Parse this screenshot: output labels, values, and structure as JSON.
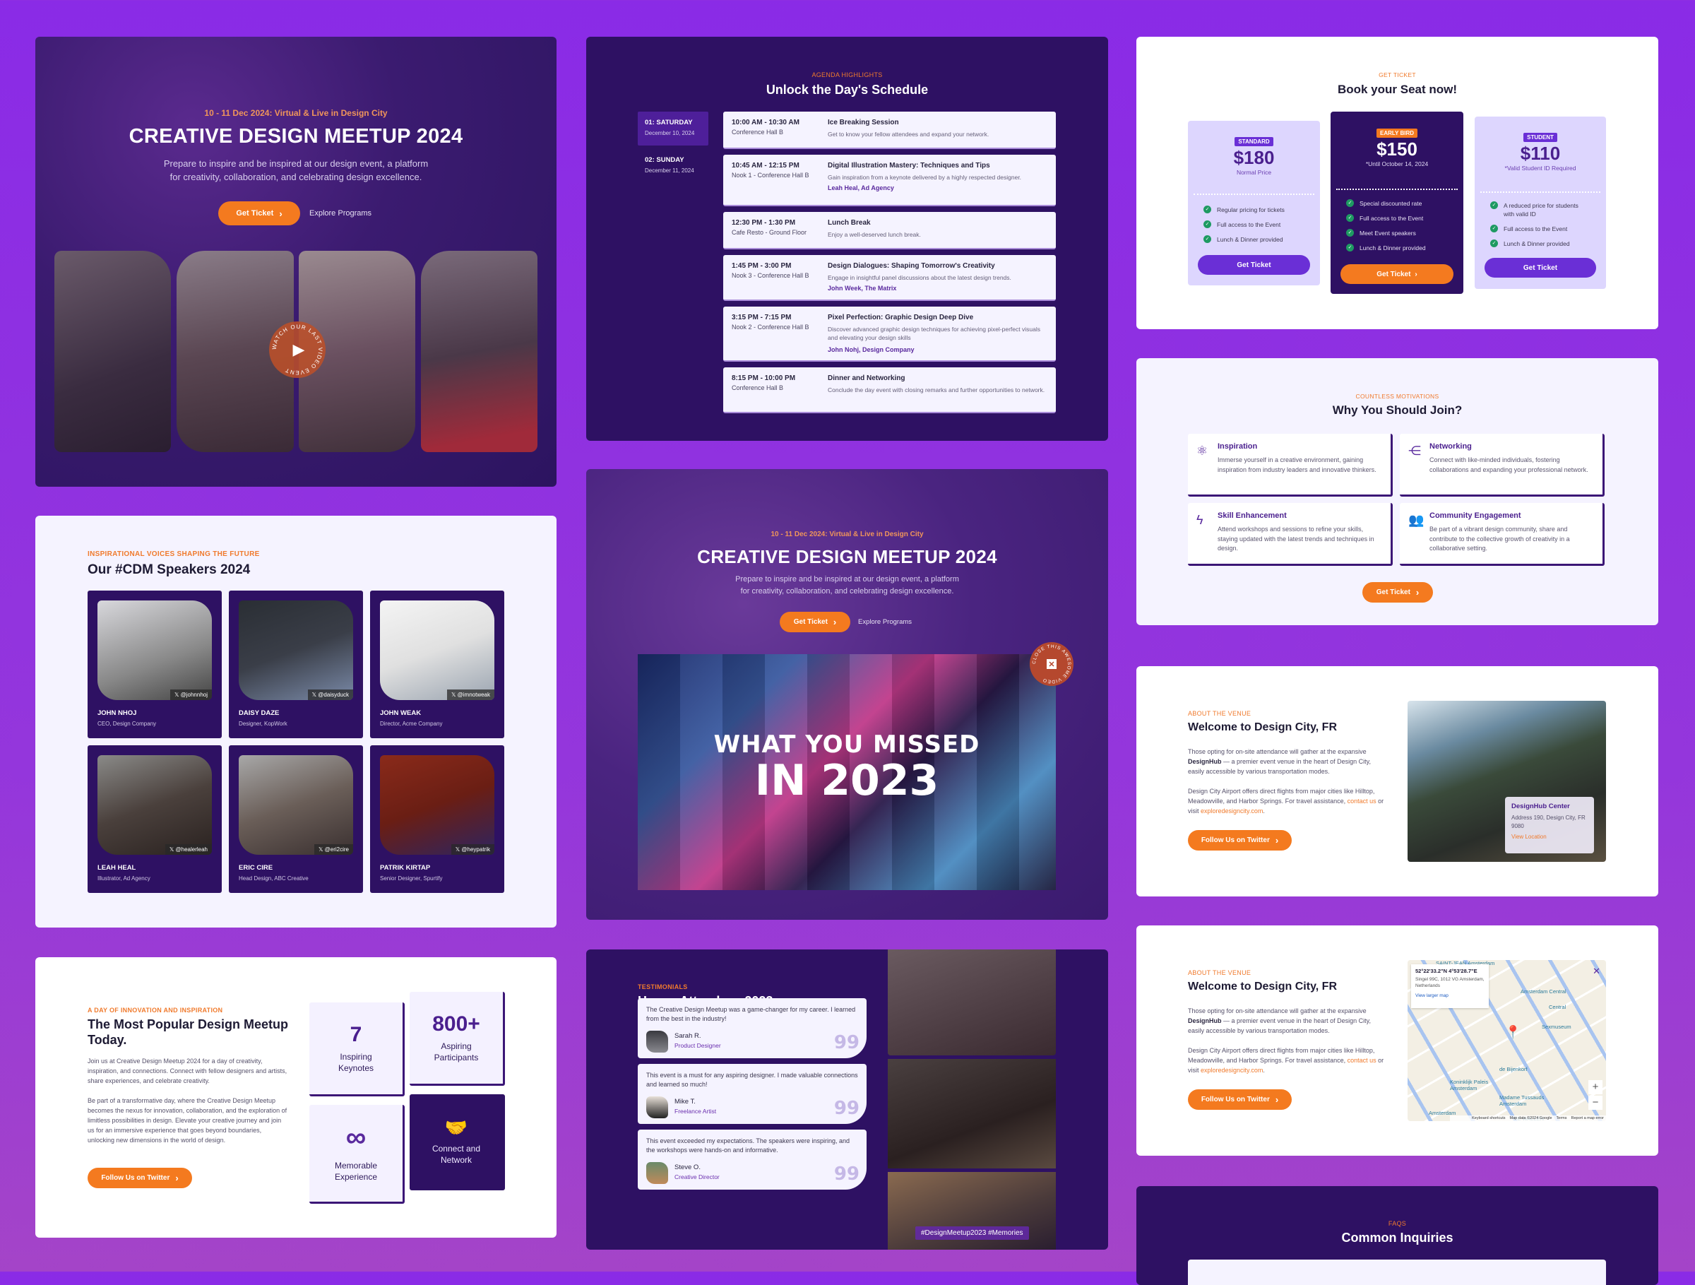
{
  "hero": {
    "date_line": "10 - 11 Dec 2024: Virtual & Live in Design City",
    "title": "CREATIVE DESIGN MEETUP 2024",
    "subtitle_1": "Prepare to inspire and be inspired at our design event, a platform",
    "subtitle_2": "for creativity, collaboration, and celebrating design excellence.",
    "get_ticket": "Get Ticket",
    "explore": "Explore Programs",
    "watch_badge": "WATCH OUR LAST VIDEO EVENT",
    "play_icon": "play-icon"
  },
  "hero_video": {
    "date_line": "10 - 11 Dec 2024: Virtual & Live in Design City",
    "title": "CREATIVE DESIGN MEETUP 2024",
    "subtitle_1": "Prepare to inspire and be inspired at our design event, a platform",
    "subtitle_2": "for creativity, collaboration, and celebrating design excellence.",
    "get_ticket": "Get Ticket",
    "explore": "Explore Programs",
    "video_line_1": "WHAT YOU MISSED",
    "video_line_2": "IN 2023",
    "close_badge": "CLOSE THIS AWESOME VIDEO"
  },
  "schedule": {
    "eyebrow": "AGENDA HIGHLIGHTS",
    "title": "Unlock the Day's Schedule",
    "days": [
      {
        "label": "01: SATURDAY",
        "date": "December 10, 2024",
        "active": true
      },
      {
        "label": "02: SUNDAY",
        "date": "December 11, 2024",
        "active": false
      }
    ],
    "sessions": [
      {
        "time": "10:00 AM - 10:30 AM",
        "location": "Conference Hall B",
        "title": "Ice Breaking Session",
        "desc": "Get to know your fellow attendees and expand your network.",
        "speaker": ""
      },
      {
        "time": "10:45 AM - 12:15 PM",
        "location": "Nook 1 - Conference Hall B",
        "title": "Digital Illustration Mastery: Techniques and Tips",
        "desc": "Gain inspiration from a keynote delivered by a highly respected designer.",
        "speaker": "Leah Heal, Ad Agency"
      },
      {
        "time": "12:30 PM - 1:30 PM",
        "location": "Cafe Resto - Ground Floor",
        "title": "Lunch Break",
        "desc": "Enjoy a well-deserved lunch break.",
        "speaker": ""
      },
      {
        "time": "1:45 PM - 3:00 PM",
        "location": "Nook 3 - Conference Hall B",
        "title": "Design Dialogues: Shaping Tomorrow's Creativity",
        "desc": "Engage in insightful panel discussions about the latest design trends.",
        "speaker": "John Week, The Matrix"
      },
      {
        "time": "3:15 PM - 7:15 PM",
        "location": "Nook 2 - Conference Hall B",
        "title": "Pixel Perfection: Graphic Design Deep Dive",
        "desc": "Discover advanced graphic design techniques for achieving pixel-perfect visuals and elevating your design skills",
        "speaker": "John Nohj, Design Company"
      },
      {
        "time": "8:15 PM - 10:00 PM",
        "location": "Conference Hall B",
        "title": "Dinner and Networking",
        "desc": "Conclude the day event with closing remarks and further opportunities to network.",
        "speaker": ""
      }
    ]
  },
  "pricing": {
    "eyebrow": "GET TICKET",
    "title": "Book your Seat now!",
    "plans": [
      {
        "badge": "STANDARD",
        "price": "$180",
        "note": "Normal Price",
        "features": [
          "Regular pricing for tickets",
          "Full access to the Event",
          "Lunch & Dinner provided"
        ],
        "cta": "Get Ticket"
      },
      {
        "badge": "EARLY BIRD",
        "price": "$150",
        "note": "*Until October 14, 2024",
        "features": [
          "Special discounted rate",
          "Full access to the Event",
          "Meet Event speakers",
          "Lunch & Dinner provided"
        ],
        "cta": "Get Ticket"
      },
      {
        "badge": "STUDENT",
        "price": "$110",
        "note": "*Valid Student ID Required",
        "features": [
          "A reduced price for students with valid ID",
          "Full access to the Event",
          "Lunch & Dinner provided"
        ],
        "cta": "Get Ticket"
      }
    ]
  },
  "why": {
    "eyebrow": "COUNTLESS MOTIVATIONS",
    "title": "Why You Should Join?",
    "items": [
      {
        "icon": "atom-icon",
        "title": "Inspiration",
        "desc": "Immerse yourself in a creative environment, gaining inspiration from industry leaders and innovative thinkers."
      },
      {
        "icon": "share-icon",
        "title": "Networking",
        "desc": "Connect with like-minded individuals, fostering collaborations and expanding your professional network."
      },
      {
        "icon": "lightning-icon",
        "title": "Skill Enhancement",
        "desc": "Attend workshops and sessions to refine your skills, staying updated with the latest trends and techniques in design."
      },
      {
        "icon": "community-icon",
        "title": "Community Engagement",
        "desc": "Be part of a vibrant design community, share and contribute to the collective growth of creativity in a collaborative setting."
      }
    ],
    "cta": "Get Ticket"
  },
  "speakers": {
    "eyebrow": "INSPIRATIONAL VOICES SHAPING THE FUTURE",
    "title": "Our #CDM Speakers 2024",
    "items": [
      {
        "name": "JOHN NHOJ",
        "role": "CEO, Design Company",
        "handle": "@johnnhoj"
      },
      {
        "name": "DAISY DAZE",
        "role": "Designer, KopWork",
        "handle": "@daisyduck"
      },
      {
        "name": "JOHN WEAK",
        "role": "Director, Acme Company",
        "handle": "@imnotweak"
      },
      {
        "name": "LEAH HEAL",
        "role": "Illustrator, Ad Agency",
        "handle": "@healerleah"
      },
      {
        "name": "ERIC CIRE",
        "role": "Head Design, ABC Creative",
        "handle": "@eri2cire"
      },
      {
        "name": "PATRIK KIRTAP",
        "role": "Senior Designer, Spurtify",
        "handle": "@heypatrik"
      }
    ]
  },
  "venue": {
    "eyebrow": "ABOUT THE VENUE",
    "title": "Welcome to Design City, FR",
    "p1_a": "Those opting for on-site attendance will gather at the expansive ",
    "p1_bold": "DesignHub",
    "p1_b": " — a premier event venue in the heart of Design City, easily accessible by various transportation modes.",
    "p2_a": "Design City Airport offers direct flights from major cities like Hilltop, Meadowville, and Harbor Springs. For travel assistance, ",
    "p2_link1": "contact us",
    "p2_mid": " or visit ",
    "p2_link2": "exploredesigncity.com",
    "p2_end": ".",
    "cta": "Follow Us on Twitter",
    "location_card": {
      "name": "DesignHub Center",
      "address": "Address 190, Design City, FR 9080",
      "link": "View Location"
    },
    "map": {
      "coords": "52°22'33.2\"N 4°53'28.7\"E",
      "address": "Singel 99C, 1012 VG Amsterdam, Netherlands",
      "larger": "View larger map",
      "labels": [
        "Amsterdam Central",
        "Central",
        "Sexmuseum",
        "de Bijenkorf",
        "Koninklijk Paleis Amsterdam",
        "Madame Tussauds Amsterdam",
        "DE WALLEN",
        "Amsterdam",
        "SAINT-JEAN Amsterdam"
      ],
      "footer": [
        "Keyboard shortcuts",
        "Map data ©2024 Google",
        "Terms",
        "Report a map error"
      ],
      "zoom_in": "+",
      "zoom_out": "−"
    }
  },
  "about": {
    "eyebrow": "A DAY OF INNOVATION AND INSPIRATION",
    "title": "The Most Popular Design Meetup Today.",
    "p1": "Join us at Creative Design Meetup 2024 for a day of creativity, inspiration, and connections. Connect with fellow designers and artists, share experiences, and celebrate creativity.",
    "p2": "Be part of a transformative day, where the Creative Design Meetup becomes the nexus for innovation, collaboration, and the exploration of limitless possibilities in design. Elevate your creative journey and join us for an immersive experience that goes beyond boundaries, unlocking new dimensions in the world of design.",
    "cta": "Follow Us on Twitter",
    "stats": [
      {
        "value": "7",
        "label": "Inspiring Keynotes"
      },
      {
        "value": "800+",
        "label": "Aspiring Participants"
      },
      {
        "icon": "infinity-icon",
        "label": "Memorable Experience"
      },
      {
        "icon": "handshake-icon",
        "label": "Connect and Network"
      }
    ]
  },
  "testimonials": {
    "eyebrow": "TESTIMONIALS",
    "title": "Happy Attendees 2023",
    "items": [
      {
        "quote": "The Creative Design Meetup was a game-changer for my career. I learned from the best in the industry!",
        "name": "Sarah R.",
        "role": "Product Designer"
      },
      {
        "quote": "This event is a must for any aspiring designer. I made valuable connections and learned so much!",
        "name": "Mike T.",
        "role": "Freelance Artist"
      },
      {
        "quote": "This event exceeded my expectations. The speakers were inspiring, and the workshops were hands-on and informative.",
        "name": "Steve O.",
        "role": "Creative Director"
      }
    ],
    "hashtag": "#DesignMeetup2023 #Memories"
  },
  "faq": {
    "eyebrow": "FAQS",
    "title": "Common Inquiries"
  },
  "colors": {
    "accent": "#f47a1f",
    "primary": "#6a2fd6",
    "dark": "#2e1163",
    "background": "#8a2be6"
  }
}
